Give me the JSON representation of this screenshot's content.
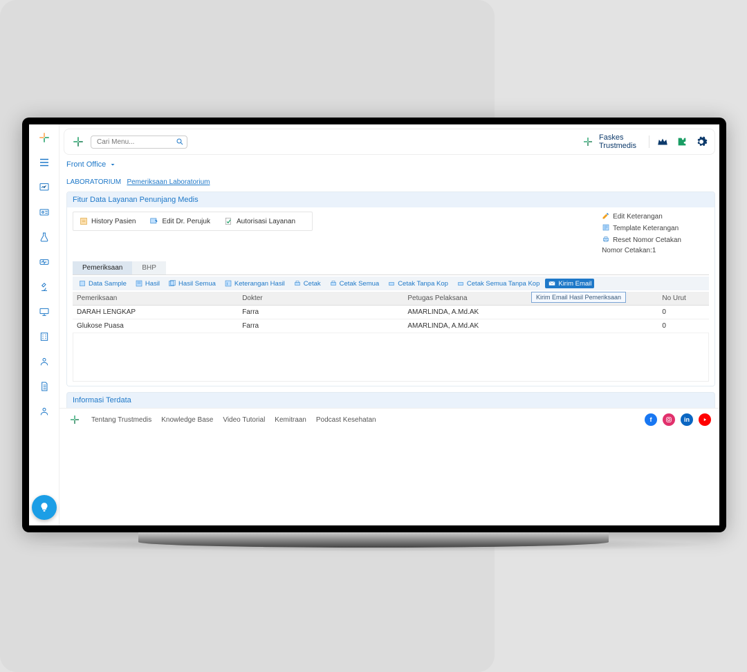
{
  "topbar": {
    "search_placeholder": "Cari Menu...",
    "faskes_line1": "Faskes",
    "faskes_line2": "Trustmedis"
  },
  "nav": {
    "front_office": "Front Office"
  },
  "breadcrumb": {
    "section": "LABORATORIUM",
    "page": "Pemeriksaan Laboratorium"
  },
  "panel": {
    "title": "Fitur Data Layanan Penunjang Medis",
    "left_buttons": {
      "history_pasien": "History Pasien",
      "edit_perujuk": "Edit Dr. Perujuk",
      "autorisasi": "Autorisasi Layanan"
    },
    "right_items": {
      "edit_keterangan": "Edit Keterangan",
      "template_keterangan": "Template Keterangan",
      "reset_cetakan": "Reset Nomor Cetakan",
      "nomor_cetakan_label": "Nomor Cetakan:",
      "nomor_cetakan_value": "1"
    }
  },
  "tabs": {
    "pemeriksaan": "Pemeriksaan",
    "bhp": "BHP"
  },
  "toolbar": {
    "data_sample": "Data Sample",
    "hasil": "Hasil",
    "hasil_semua": "Hasil Semua",
    "keterangan_hasil": "Keterangan Hasil",
    "cetak": "Cetak",
    "cetak_semua": "Cetak Semua",
    "cetak_tanpa_kop": "Cetak Tanpa Kop",
    "cetak_semua_tanpa_kop": "Cetak Semua Tanpa Kop",
    "kirim_email": "Kirim Email",
    "tooltip": "Kirim Email Hasil Pemeriksaan"
  },
  "table": {
    "headers": {
      "pemeriksaan": "Pemeriksaan",
      "dokter": "Dokter",
      "petugas": "Petugas Pelaksana",
      "no_urut": "No Urut"
    },
    "rows": [
      {
        "pemeriksaan": "DARAH LENGKAP",
        "dokter": "Farra",
        "petugas": "AMARLINDA, A.Md.AK",
        "no_urut": "0"
      },
      {
        "pemeriksaan": "Glukose Puasa",
        "dokter": "Farra",
        "petugas": "AMARLINDA, A.Md.AK",
        "no_urut": "0"
      }
    ]
  },
  "info": {
    "title": "Informasi Terdata"
  },
  "footer": {
    "links": {
      "tentang": "Tentang Trustmedis",
      "kb": "Knowledge Base",
      "video": "Video Tutorial",
      "kemitraan": "Kemitraan",
      "podcast": "Podcast Kesehatan"
    }
  }
}
